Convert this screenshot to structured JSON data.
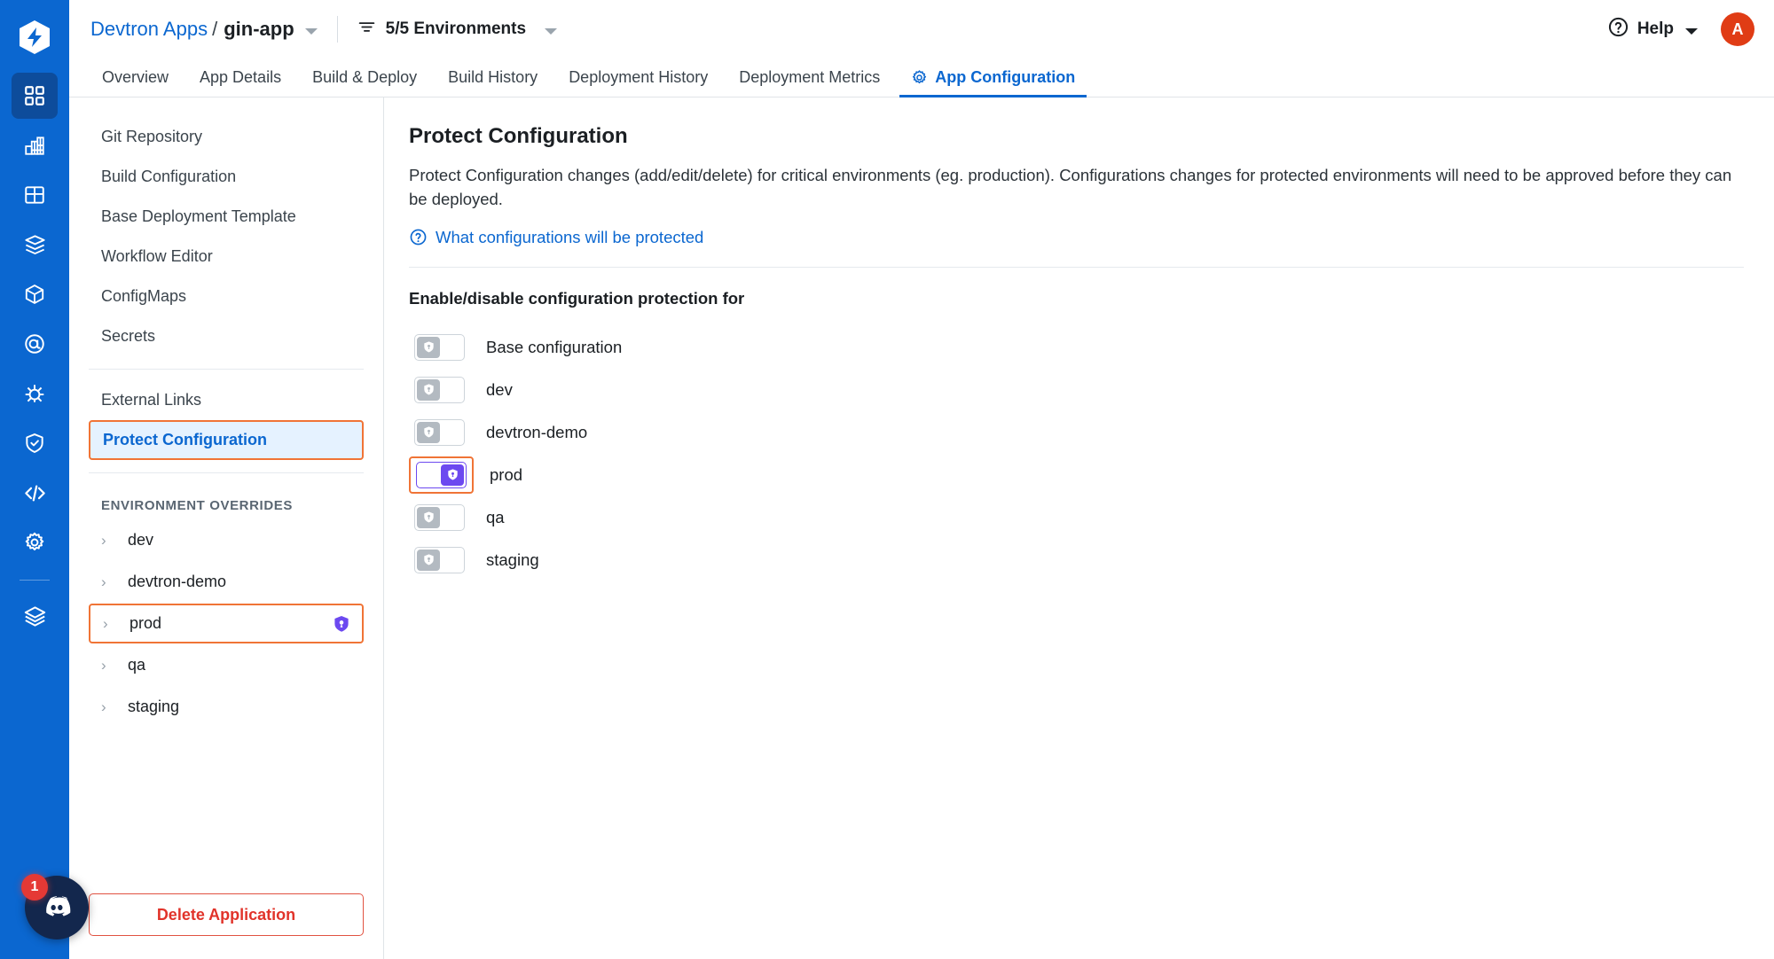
{
  "rail": {
    "logo_icon": "devtron-logo-icon",
    "items": [
      {
        "icon": "applications-grid-icon",
        "name": "applications",
        "active": true
      },
      {
        "icon": "jobs-chart-icon",
        "name": "jobs",
        "active": false
      },
      {
        "icon": "app-groups-icon",
        "name": "application-groups",
        "active": false
      },
      {
        "icon": "chart-store-box-icon",
        "name": "chart-store",
        "active": false
      },
      {
        "icon": "cube-package-icon",
        "name": "software-distribution",
        "active": false
      },
      {
        "icon": "target-at-icon",
        "name": "resource-browser",
        "active": false
      },
      {
        "icon": "bug-icon",
        "name": "bulk-edit",
        "active": false
      },
      {
        "icon": "shield-check-icon",
        "name": "security",
        "active": false
      },
      {
        "icon": "code-brackets-icon",
        "name": "code",
        "active": false
      },
      {
        "icon": "gear-icon",
        "name": "global-configurations",
        "active": false
      },
      {
        "icon": "stack-layers-icon",
        "name": "stack-manager",
        "active": false
      }
    ],
    "discord": {
      "icon": "discord-icon",
      "badge": "1"
    }
  },
  "topbar": {
    "breadcrumb_root": "Devtron Apps",
    "breadcrumb_sep": "/",
    "breadcrumb_current": "gin-app",
    "app_dropdown_icon": "chevron-down-icon",
    "filter_icon": "filter-icon",
    "env_selector_label": "5/5 Environments",
    "env_dropdown_icon": "chevron-down-icon",
    "help_icon": "question-circle-icon",
    "help_label": "Help",
    "help_dropdown_icon": "chevron-down-icon",
    "avatar_initial": "A",
    "avatar_color": "#e03c15"
  },
  "tabs": [
    {
      "label": "Overview",
      "active": false,
      "icon": ""
    },
    {
      "label": "App Details",
      "active": false,
      "icon": ""
    },
    {
      "label": "Build & Deploy",
      "active": false,
      "icon": ""
    },
    {
      "label": "Build History",
      "active": false,
      "icon": ""
    },
    {
      "label": "Deployment History",
      "active": false,
      "icon": ""
    },
    {
      "label": "Deployment Metrics",
      "active": false,
      "icon": ""
    },
    {
      "label": "App Configuration",
      "active": true,
      "icon": "gear-icon"
    }
  ],
  "config_nav": {
    "items": [
      {
        "label": "Git Repository",
        "selected": false
      },
      {
        "label": "Build Configuration",
        "selected": false
      },
      {
        "label": "Base Deployment Template",
        "selected": false
      },
      {
        "label": "Workflow Editor",
        "selected": false
      },
      {
        "label": "ConfigMaps",
        "selected": false
      },
      {
        "label": "Secrets",
        "selected": false
      }
    ],
    "items_after_divider": [
      {
        "label": "External Links",
        "selected": false
      },
      {
        "label": "Protect Configuration",
        "selected": true
      }
    ],
    "section_title": "ENVIRONMENT OVERRIDES",
    "environments": [
      {
        "label": "dev",
        "protected": false,
        "highlighted": false
      },
      {
        "label": "devtron-demo",
        "protected": false,
        "highlighted": false
      },
      {
        "label": "prod",
        "protected": true,
        "highlighted": true
      },
      {
        "label": "qa",
        "protected": false,
        "highlighted": false
      },
      {
        "label": "staging",
        "protected": false,
        "highlighted": false
      }
    ],
    "delete_button": "Delete Application"
  },
  "main": {
    "title": "Protect Configuration",
    "description": "Protect Configuration changes (add/edit/delete) for critical environments (eg. production). Configurations changes for protected environments will need to be approved before they can be deployed.",
    "help_link": "What configurations will be protected",
    "help_link_icon": "question-circle-icon",
    "section_label": "Enable/disable configuration protection for",
    "toggles": [
      {
        "label": "Base configuration",
        "enabled": false,
        "highlighted": false
      },
      {
        "label": "dev",
        "enabled": false,
        "highlighted": false
      },
      {
        "label": "devtron-demo",
        "enabled": false,
        "highlighted": false
      },
      {
        "label": "prod",
        "enabled": true,
        "highlighted": true
      },
      {
        "label": "qa",
        "enabled": false,
        "highlighted": false
      },
      {
        "label": "staging",
        "enabled": false,
        "highlighted": false
      }
    ]
  },
  "colors": {
    "brand_blue": "#0b67d0",
    "accent_purple": "#6c49f0",
    "highlight_orange": "#f07436",
    "danger_red": "#e1332a"
  }
}
